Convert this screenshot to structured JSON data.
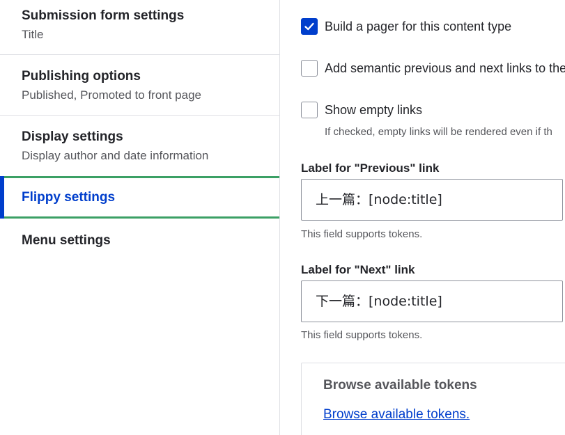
{
  "sidebar": {
    "tabs": [
      {
        "title": "Submission form settings",
        "summary": "Title"
      },
      {
        "title": "Publishing options",
        "summary": "Published, Promoted to front page"
      },
      {
        "title": "Display settings",
        "summary": "Display author and date information"
      },
      {
        "title": "Flippy settings",
        "summary": ""
      },
      {
        "title": "Menu settings",
        "summary": ""
      }
    ],
    "active_tab": "Flippy settings"
  },
  "main": {
    "options": [
      {
        "label": "Build a pager for this content type",
        "checked": true
      },
      {
        "label": "Add semantic previous and next links to the",
        "checked": false
      },
      {
        "label": "Show empty links",
        "checked": false,
        "description": "If checked, empty links will be rendered even if th"
      }
    ],
    "previous_link": {
      "label": "Label for \"Previous\" link",
      "value": "上一篇：[node:title]",
      "description": "This field supports tokens."
    },
    "next_link": {
      "label": "Label for \"Next\" link",
      "value": "下一篇：[node:title]",
      "description": "This field supports tokens."
    },
    "tokens": {
      "title": "Browse available tokens",
      "link": "Browse available tokens."
    }
  },
  "colors": {
    "accent": "#003ecc",
    "active_border": "#3ba065",
    "text": "#232429",
    "muted": "#55565b",
    "border": "#dedfe4"
  }
}
